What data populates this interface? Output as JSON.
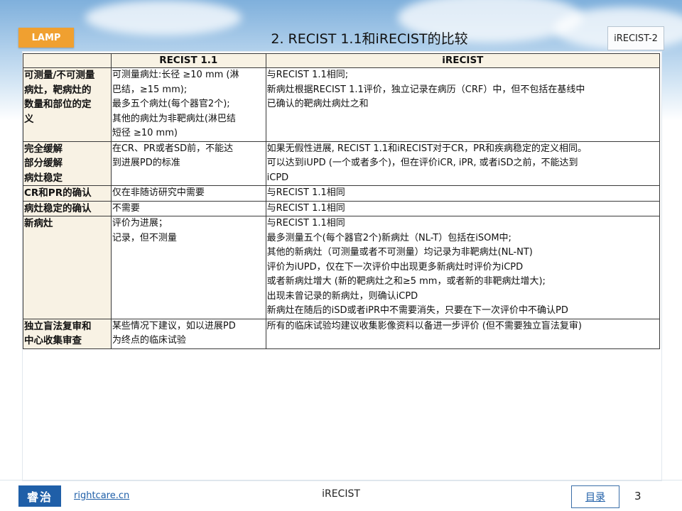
{
  "header": {
    "lamp_label": "LAMP",
    "title": "2. RECIST 1.1和iRECIST的比较",
    "tag": "iRECIST-2"
  },
  "table": {
    "columns": [
      "",
      "RECIST 1.1",
      "iRECIST"
    ],
    "rows": [
      {
        "label": [
          "可测量/不可测量",
          "病灶，靶病灶的",
          "数量和部位的定",
          "义"
        ],
        "recist": [
          "可测量病灶:长径 ≥10 mm (淋",
          "巴结，≥15 mm);",
          "最多五个病灶(每个器官2个);",
          "其他的病灶为非靶病灶(淋巴结",
          "短径 ≥10 mm)"
        ],
        "irecist": [
          "与RECIST 1.1相同;",
          "新病灶根据RECIST 1.1评价，独立记录在病历（CRF）中，但不包括在基线中",
          "已确认的靶病灶病灶之和"
        ]
      },
      {
        "label": [
          "完全缓解",
          "部分缓解",
          "病灶稳定"
        ],
        "recist": [
          "在CR、PR或者SD前，不能达",
          "到进展PD的标准"
        ],
        "irecist": [
          "如果无假性进展, RECIST 1.1和iRECIST对于CR，PR和疾病稳定的定义相同。",
          "可以达到iUPD (一个或者多个)，但在评价iCR, iPR, 或者iSD之前，不能达到",
          "iCPD"
        ]
      },
      {
        "label": [
          "CR和PR的确认"
        ],
        "recist": [
          "仅在非随访研究中需要"
        ],
        "irecist": [
          "与RECIST 1.1相同"
        ]
      },
      {
        "label": [
          "病灶稳定的确认"
        ],
        "recist": [
          "不需要"
        ],
        "irecist": [
          "与RECIST 1.1相同"
        ]
      },
      {
        "label": [
          "新病灶"
        ],
        "recist": [
          "评价为进展；",
          "记录，但不测量"
        ],
        "irecist": [
          "与RECIST 1.1相同",
          "最多测量五个(每个器官2个)新病灶（NL-T）包括在iSOM中;",
          "其他的新病灶（可测量或者不可测量）均记录为非靶病灶(NL-NT)",
          "评价为iUPD，仅在下一次评价中出现更多新病灶时评价为iCPD",
          "或者新病灶增大 (新的靶病灶之和≥5 mm，或者新的非靶病灶增大);",
          "出现未曾记录的新病灶，则确认iCPD",
          "新病灶在随后的iSD或者iPR中不需要消失，只要在下一次评价中不确认PD"
        ]
      },
      {
        "label": [
          "独立盲法复审和",
          "中心收集审查"
        ],
        "recist": [
          "某些情况下建议，如以进展PD",
          "为终点的临床试验"
        ],
        "irecist": [
          "所有的临床试验均建议收集影像资料以备进一步评价 (但不需要独立盲法复审)"
        ]
      }
    ]
  },
  "footer": {
    "logo_text": "睿治",
    "site": "rightcare.cn",
    "title": "iRECIST",
    "toc_label": "目录",
    "page_number": "3"
  },
  "colors": {
    "header_fill": "#f8f2e4",
    "lamp_orange": "#f0a030",
    "brand_blue": "#1f5fa8"
  }
}
